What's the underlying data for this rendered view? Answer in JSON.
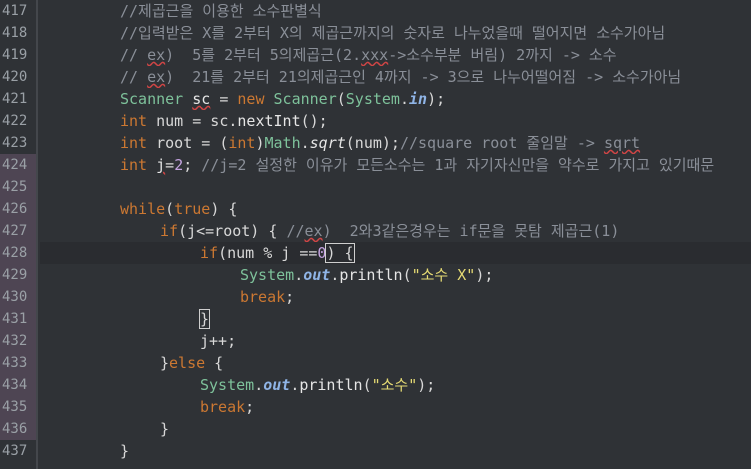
{
  "lines": [
    {
      "n": "417"
    },
    {
      "n": "418"
    },
    {
      "n": "419"
    },
    {
      "n": "420"
    },
    {
      "n": "421"
    },
    {
      "n": "422"
    },
    {
      "n": "423"
    },
    {
      "n": "424"
    },
    {
      "n": "425"
    },
    {
      "n": "426"
    },
    {
      "n": "427"
    },
    {
      "n": "428"
    },
    {
      "n": "429"
    },
    {
      "n": "430"
    },
    {
      "n": "431"
    },
    {
      "n": "432"
    },
    {
      "n": "433"
    },
    {
      "n": "434"
    },
    {
      "n": "435"
    },
    {
      "n": "436"
    },
    {
      "n": "437"
    }
  ],
  "c417": {
    "cmt": "//제곱근을 이용한 소수판별식"
  },
  "c418": {
    "cmt": "//입력받은 X를 2부터 X의 제곱근까지의 숫자로 나누었을때 떨어지면 소수가아님"
  },
  "c419": {
    "a": "// ",
    "b": "ex",
    "c": ")  5를 2부터 5의제곱근(2.",
    "d": "xxx",
    "e": "->소수부분 버림) 2까지 -> 소수"
  },
  "c420": {
    "a": "// ",
    "b": "ex",
    "c": ")  21를 2부터 21의제곱근인 4까지 -> 3으로 나누어떨어짐 -> 소수가아님"
  },
  "c421": {
    "t1": "Scanner",
    "t2": "sc",
    "t3": " = ",
    "t4": "new",
    "t5": " ",
    "t6": "Scanner",
    "t7": "(",
    "t8": "System",
    "t9": ".",
    "t10": "in",
    "t11": ");"
  },
  "c422": {
    "t1": "int",
    "t2": " num = sc.",
    "t3": "nextInt",
    "t4": "();"
  },
  "c423": {
    "t1": "int",
    "t2": " root = (",
    "t3": "int",
    "t4": ")",
    "t5": "Math",
    "t6": ".",
    "t7": "sqrt",
    "t8": "(num);",
    "t9": "//square root 줄임말 -> ",
    "t10": "sqrt"
  },
  "c424": {
    "t1": "int",
    "t2": " ",
    "t3": "j",
    "t4": "=",
    "t5": "2",
    "t6": "; ",
    "t7": "//j=2 설정한 이유가 모든소수는 1과 자기자신만을 약수로 가지고 있기때문"
  },
  "c426": {
    "t1": "while",
    "t2": "(",
    "t3": "true",
    "t4": ") {"
  },
  "c427": {
    "t1": "if",
    "t2": "(j<=root) { ",
    "t3": "//",
    "t4": "ex",
    "t5": ")  2와3같은경우는 if문을 못탐 제곱근(1)"
  },
  "c428": {
    "t1": "if",
    "t2": "(num % j ==",
    "t3": "0",
    "t4": ") {",
    "t5": ""
  },
  "c429": {
    "t1": "System",
    "t2": ".",
    "t3": "out",
    "t4": ".",
    "t5": "println",
    "t6": "(",
    "t7": "\"소수 X\"",
    "t8": ");"
  },
  "c430": {
    "t1": "break",
    "t2": ";"
  },
  "c431": {
    "t1": "}"
  },
  "c432": {
    "t1": "j++;"
  },
  "c433": {
    "t1": "}",
    "t2": "else",
    "t3": " {"
  },
  "c434": {
    "t1": "System",
    "t2": ".",
    "t3": "out",
    "t4": ".",
    "t5": "println",
    "t6": "(",
    "t7": "\"소수\"",
    "t8": ");"
  },
  "c435": {
    "t1": "break",
    "t2": ";"
  },
  "c436": {
    "t1": "}"
  },
  "c437": {
    "t1": "}"
  }
}
